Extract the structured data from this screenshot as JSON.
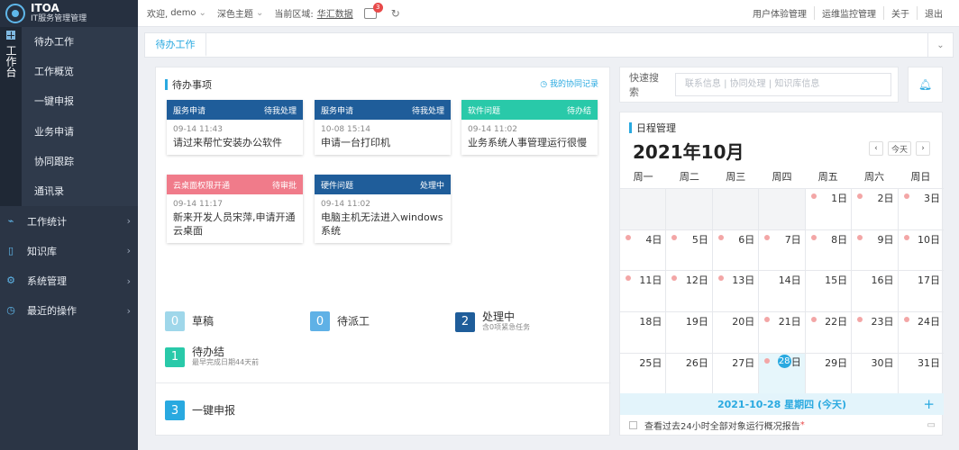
{
  "brand": {
    "name": "ITOA",
    "subtitle": "IT服务管理管理"
  },
  "sidebar": {
    "rail_label": "工作台",
    "sub_items": [
      "待办工作",
      "工作概览",
      "一键申报",
      "业务申请",
      "协同跟踪",
      "通讯录"
    ],
    "nav_items": [
      {
        "label": "工作统计",
        "icon": "chart-icon"
      },
      {
        "label": "知识库",
        "icon": "book-icon"
      },
      {
        "label": "系统管理",
        "icon": "gear-icon"
      },
      {
        "label": "最近的操作",
        "icon": "clock-icon"
      }
    ]
  },
  "topbar": {
    "welcome": "欢迎,",
    "user": "demo",
    "theme": "深色主题",
    "region_label": "当前区域:",
    "region_value": "华汇数据",
    "badge_count": "3",
    "links": [
      "用户体验管理",
      "运维监控管理",
      "关于",
      "退出"
    ]
  },
  "tabs": {
    "active": "待办工作"
  },
  "todo": {
    "title": "待办事项",
    "my_records": "我的协同记录",
    "tasks": [
      {
        "category": "服务申请",
        "status": "待我处理",
        "time": "09-14 11:43",
        "text": "请过来帮忙安装办公软件",
        "color": "#1f5d9a"
      },
      {
        "category": "服务申请",
        "status": "待我处理",
        "time": "10-08 15:14",
        "text": "申请一台打印机",
        "color": "#1f5d9a"
      },
      {
        "category": "软件问题",
        "status": "待办结",
        "time": "09-14 11:02",
        "text": "业务系统人事管理运行很慢",
        "color": "#29c9a9"
      },
      {
        "category": "云桌面权限开通",
        "status": "待审批",
        "time": "09-14 11:17",
        "text": "新来开发人员宋萍,申请开通云桌面",
        "color": "#f07b8a"
      },
      {
        "category": "硬件问题",
        "status": "处理中",
        "time": "09-14 11:02",
        "text": "电脑主机无法进入windows系统",
        "color": "#1f5d9a"
      }
    ],
    "stats": [
      {
        "count": "0",
        "label": "草稿",
        "sub": "",
        "color": "#9fd7ea"
      },
      {
        "count": "0",
        "label": "待派工",
        "sub": "",
        "color": "#5fb1e6"
      },
      {
        "count": "2",
        "label": "处理中",
        "sub": "含0项紧急任务",
        "color": "#1f5d9a"
      },
      {
        "count": "1",
        "label": "待办结",
        "sub": "最早完成日期44天前",
        "color": "#29c9a9"
      }
    ],
    "quick": {
      "count": "3",
      "label": "一键申报",
      "color": "#29a9e0"
    }
  },
  "search": {
    "label": "快速搜索",
    "placeholder": "联系信息 | 协同处理 | 知识库信息"
  },
  "calendar": {
    "title": "日程管理",
    "month": "2021年10月",
    "today_btn": "今天",
    "weekdays": [
      "周一",
      "周二",
      "周三",
      "周四",
      "周五",
      "周六",
      "周日"
    ],
    "weeks": [
      [
        null,
        null,
        null,
        null,
        {
          "d": "1日",
          "dot": true
        },
        {
          "d": "2日",
          "dot": true
        },
        {
          "d": "3日",
          "dot": true
        }
      ],
      [
        {
          "d": "4日",
          "dot": true
        },
        {
          "d": "5日",
          "dot": true
        },
        {
          "d": "6日",
          "dot": true
        },
        {
          "d": "7日",
          "dot": true
        },
        {
          "d": "8日",
          "dot": true
        },
        {
          "d": "9日",
          "dot": true
        },
        {
          "d": "10日",
          "dot": true
        }
      ],
      [
        {
          "d": "11日",
          "dot": true
        },
        {
          "d": "12日",
          "dot": true
        },
        {
          "d": "13日",
          "dot": true
        },
        {
          "d": "14日",
          "dot": false
        },
        {
          "d": "15日",
          "dot": false
        },
        {
          "d": "16日",
          "dot": false
        },
        {
          "d": "17日",
          "dot": false
        }
      ],
      [
        {
          "d": "18日",
          "dot": false
        },
        {
          "d": "19日",
          "dot": false
        },
        {
          "d": "20日",
          "dot": false
        },
        {
          "d": "21日",
          "dot": true
        },
        {
          "d": "22日",
          "dot": true
        },
        {
          "d": "23日",
          "dot": true
        },
        {
          "d": "24日",
          "dot": true
        }
      ],
      [
        {
          "d": "25日",
          "dot": false
        },
        {
          "d": "26日",
          "dot": false
        },
        {
          "d": "27日",
          "dot": false
        },
        {
          "d": "28",
          "dot": true,
          "today": true
        },
        {
          "d": "29日",
          "dot": false
        },
        {
          "d": "30日",
          "dot": false
        },
        {
          "d": "31日",
          "dot": false
        }
      ]
    ],
    "today_suffix": "日",
    "selected_date": "2021-10-28 星期四 (今天)",
    "event": "查看过去24小时全部对象运行概况报告",
    "event_required": "*"
  }
}
